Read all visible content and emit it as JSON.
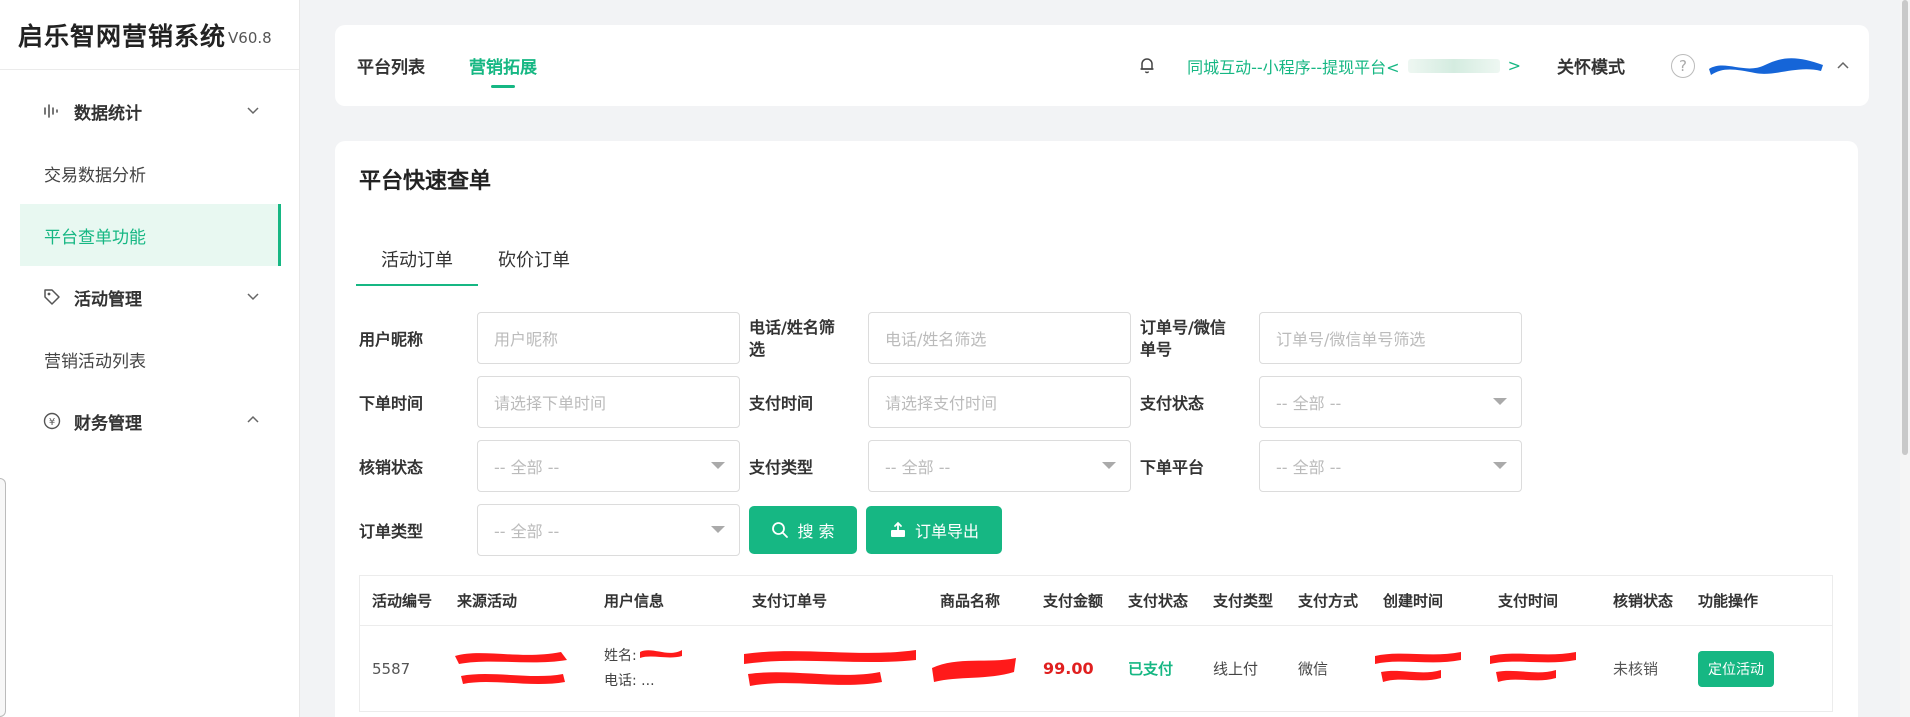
{
  "app": {
    "title": "启乐智网营销系统",
    "version": "V60.8"
  },
  "sidebar": {
    "groups": [
      {
        "label": "数据统计",
        "icon": "bar-chart-icon",
        "expanded": false,
        "items": [
          "交易数据分析",
          "平台查单功能"
        ]
      },
      {
        "label": "活动管理",
        "icon": "tag-icon",
        "expanded": false,
        "items": [
          "营销活动列表"
        ]
      },
      {
        "label": "财务管理",
        "icon": "yen-icon",
        "expanded": true,
        "items": []
      }
    ],
    "items": {
      "trade_analysis": "交易数据分析",
      "platform_query": "平台查单功能",
      "activity_list": "营销活动列表"
    },
    "active_item": "平台查单功能"
  },
  "topbar": {
    "nav": [
      {
        "label": "平台列表",
        "active": false
      },
      {
        "label": "营销拓展",
        "active": true
      }
    ],
    "platform_prefix": "同城互动--小程序--提现平台<",
    "platform_suffix": ">",
    "care_mode": "关怀模式",
    "help": "?"
  },
  "page": {
    "title": "平台快速查单",
    "tabs": [
      {
        "label": "活动订单",
        "active": true
      },
      {
        "label": "砍价订单",
        "active": false
      }
    ]
  },
  "filters": {
    "nickname": {
      "label": "用户昵称",
      "placeholder": "用户昵称"
    },
    "phone_name": {
      "label": "电话/姓名筛选",
      "placeholder": "电话/姓名筛选"
    },
    "order_no": {
      "label": "订单号/微信单号",
      "placeholder": "订单号/微信单号筛选"
    },
    "order_time": {
      "label": "下单时间",
      "placeholder": "请选择下单时间"
    },
    "pay_time": {
      "label": "支付时间",
      "placeholder": "请选择支付时间"
    },
    "pay_status": {
      "label": "支付状态",
      "value": "-- 全部 --"
    },
    "verify_status": {
      "label": "核销状态",
      "value": "-- 全部 --"
    },
    "pay_type": {
      "label": "支付类型",
      "value": "-- 全部 --"
    },
    "order_platform": {
      "label": "下单平台",
      "value": "-- 全部 --"
    },
    "order_type": {
      "label": "订单类型",
      "value": "-- 全部 --"
    },
    "search_label": "搜 索",
    "export_label": "订单导出"
  },
  "table": {
    "columns": [
      "活动编号",
      "来源活动",
      "用户信息",
      "支付订单号",
      "商品名称",
      "支付金额",
      "支付状态",
      "支付类型",
      "支付方式",
      "创建时间",
      "支付时间",
      "核销状态",
      "功能操作"
    ],
    "rows": [
      {
        "id": "5587",
        "name_label": "姓名:",
        "phone_label": "电话: ...",
        "amount": "99.00",
        "pay_status": "已支付",
        "pay_type": "线上付",
        "pay_method": "微信",
        "verify_status": "未核销",
        "action": "定位活动"
      }
    ]
  },
  "colors": {
    "accent": "#16b783",
    "amount": "#e02020",
    "redaction_red": "#ff1a1a",
    "redaction_blue": "#1565d8"
  }
}
